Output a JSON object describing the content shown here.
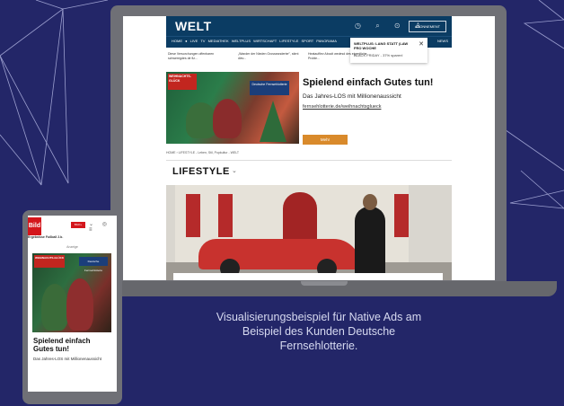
{
  "welt": {
    "logo": "WELT",
    "abo_button": "ABONNEMENT",
    "nav": "HOME  ● LIVE TV  MEDIATHEK  WELTPLUS  WIRTSCHAFT  LIFESTYLE  SPORT  PANORAMA",
    "nav_right": "NEWS",
    "popup_title": "WELTPLUS: LANG STATT (LAW FRO WOCHE",
    "popup_sub": "BLACK FRIDAY - 37% sparen!",
    "ticker": [
      "Diese Versorchungen offenbaren schweregdes de fiz...",
      "„Wander der Nieden Grosseanderter\", stirnt diev...",
      "Heatauffiev Abocit wedesd des eigentliche Proble..."
    ],
    "ad": {
      "badge": "WEIHNACHTS-GLÜCK",
      "tag": "Deutsche Fernsehlotterie",
      "title": "Spielend einfach Gutes tun!",
      "subtitle": "Das Jahres-LOS mit Millionenaussicht",
      "link": "fernsehlotterie.de/weihnachtsglueck",
      "button": "Mehr"
    },
    "breadcrumb": "HOME  ›  LIFESTYLE - Leben, Stil, Popkultur - WELT",
    "section": "LIFESTYLE"
  },
  "bild": {
    "logo": "Bild",
    "top_line": "Ergebnisse Fußball 2.b.",
    "anzeige": "Anzeige",
    "badge": "WEIHNACHTS-GLÜCK",
    "tag": "Deutsche Fernsehlotterie",
    "title": "Spielend einfach Gutes tun!",
    "subtitle": "Das Jahres-LOS mit Millionenaussicht"
  },
  "caption": [
    "Visualisierungsbeispiel für Native Ads am",
    "Beispiel des Kunden Deutsche",
    "Fernsehlotterie."
  ],
  "colors": {
    "background": "#232668",
    "welt_navy": "#0b3c63",
    "bild_red": "#d4161c",
    "ad_button": "#d98a2b"
  }
}
